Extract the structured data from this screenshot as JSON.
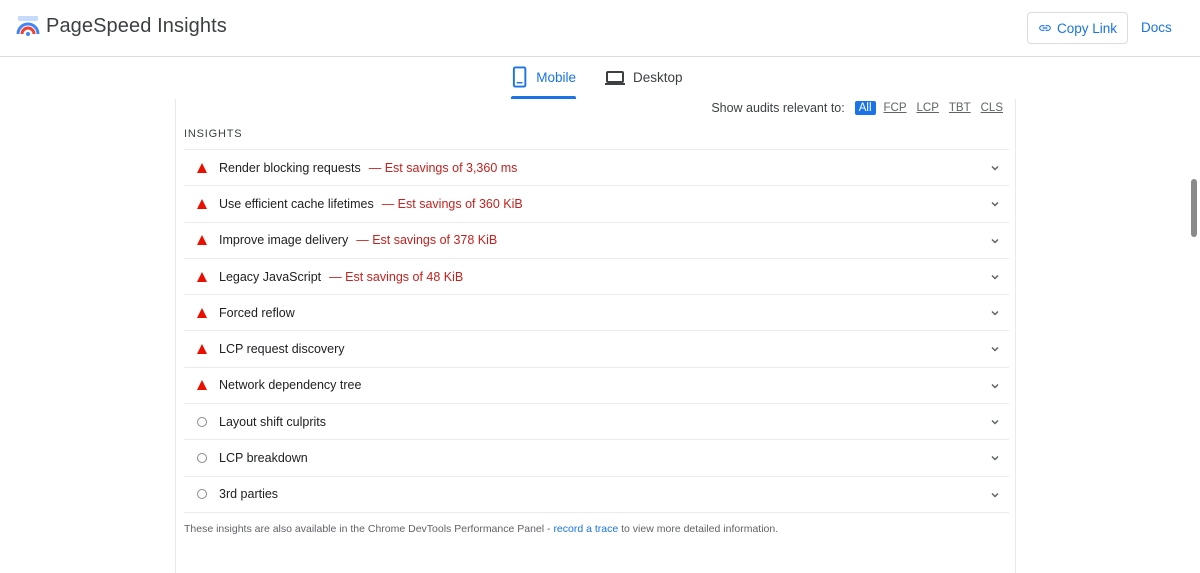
{
  "header": {
    "app_title": "PageSpeed Insights",
    "copy_link_label": "Copy Link",
    "docs_label": "Docs",
    "accent_color": "#1a73e8"
  },
  "tabs": [
    {
      "label": "Mobile",
      "icon": "mobile-phone-icon",
      "selected": true
    },
    {
      "label": "Desktop",
      "icon": "laptop-icon",
      "selected": false
    }
  ],
  "filter": {
    "label": "Show audits relevant to:",
    "options": [
      "All",
      "FCP",
      "LCP",
      "TBT",
      "CLS"
    ],
    "selected": "All"
  },
  "section_title": "INSIGHTS",
  "insights": [
    {
      "title": "Render blocking requests",
      "savings": "— Est savings of 3,360 ms",
      "status": "fail"
    },
    {
      "title": "Use efficient cache lifetimes",
      "savings": "— Est savings of 360 KiB",
      "status": "fail"
    },
    {
      "title": "Improve image delivery",
      "savings": "— Est savings of 378 KiB",
      "status": "fail"
    },
    {
      "title": "Legacy JavaScript",
      "savings": "— Est savings of 48 KiB",
      "status": "fail"
    },
    {
      "title": "Forced reflow",
      "savings": "",
      "status": "fail"
    },
    {
      "title": "LCP request discovery",
      "savings": "",
      "status": "fail"
    },
    {
      "title": "Network dependency tree",
      "savings": "",
      "status": "fail"
    },
    {
      "title": "Layout shift culprits",
      "savings": "",
      "status": "info"
    },
    {
      "title": "LCP breakdown",
      "savings": "",
      "status": "info"
    },
    {
      "title": "3rd parties",
      "savings": "",
      "status": "info"
    }
  ],
  "footnote": {
    "before": "These insights are also available in the Chrome DevTools Performance Panel - ",
    "link": "record a trace",
    "after": " to view more detailed information."
  },
  "colors": {
    "fail": "#eb0f00",
    "savings_text": "#c5221f",
    "info": "#8a8a8a"
  }
}
